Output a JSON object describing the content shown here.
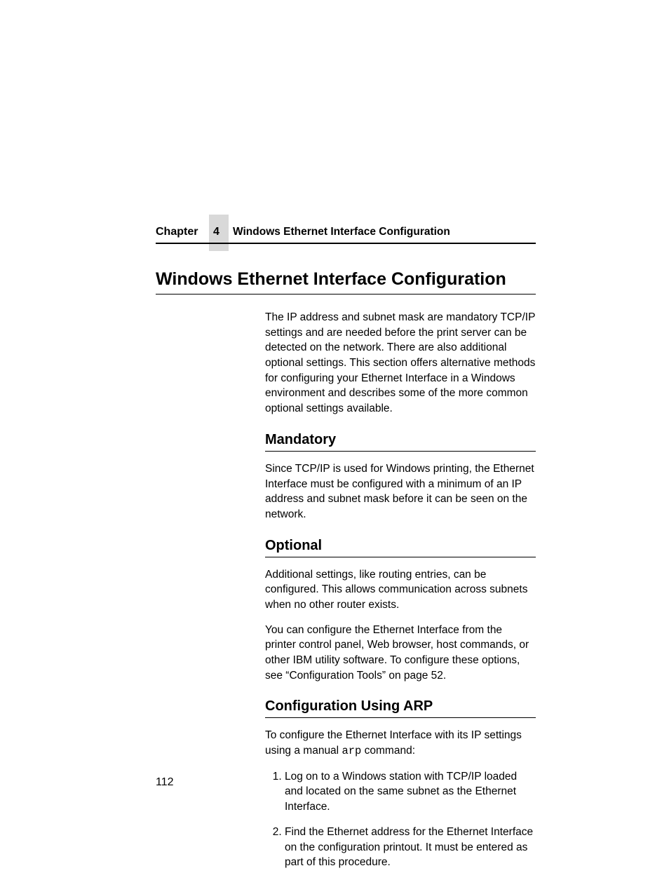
{
  "header": {
    "chapter_label": "Chapter",
    "chapter_number": "4",
    "chapter_title": "Windows Ethernet Interface Configuration"
  },
  "title": "Windows Ethernet Interface Configuration",
  "intro": "The IP address and subnet mask are mandatory TCP/IP settings and are needed before the print server can be detected on the network. There are also additional optional settings. This section offers alternative methods for configuring your Ethernet Interface in a Windows environment and describes some of the more common optional settings available.",
  "sections": {
    "mandatory": {
      "heading": "Mandatory",
      "body": "Since TCP/IP is used for Windows printing, the Ethernet Interface must be configured with a minimum of an IP address and subnet mask before it can be seen on the network."
    },
    "optional": {
      "heading": "Optional",
      "p1": "Additional settings, like routing entries, can be configured. This allows communication across subnets when no other router exists.",
      "p2": "You can configure the Ethernet Interface from the printer control panel, Web browser, host commands, or other IBM utility software. To configure these options, see “Configuration Tools” on page 52."
    },
    "arp": {
      "heading": "Configuration Using ARP",
      "intro_pre": "To configure the Ethernet Interface with its IP settings using a manual ",
      "intro_code": "arp",
      "intro_post": " command:",
      "steps": [
        "Log on to a Windows station with TCP/IP loaded and located on the same subnet as the Ethernet Interface.",
        "Find the Ethernet address for the Ethernet Interface on the configuration printout. It must be entered as part of this procedure."
      ]
    }
  },
  "page_number": "112"
}
